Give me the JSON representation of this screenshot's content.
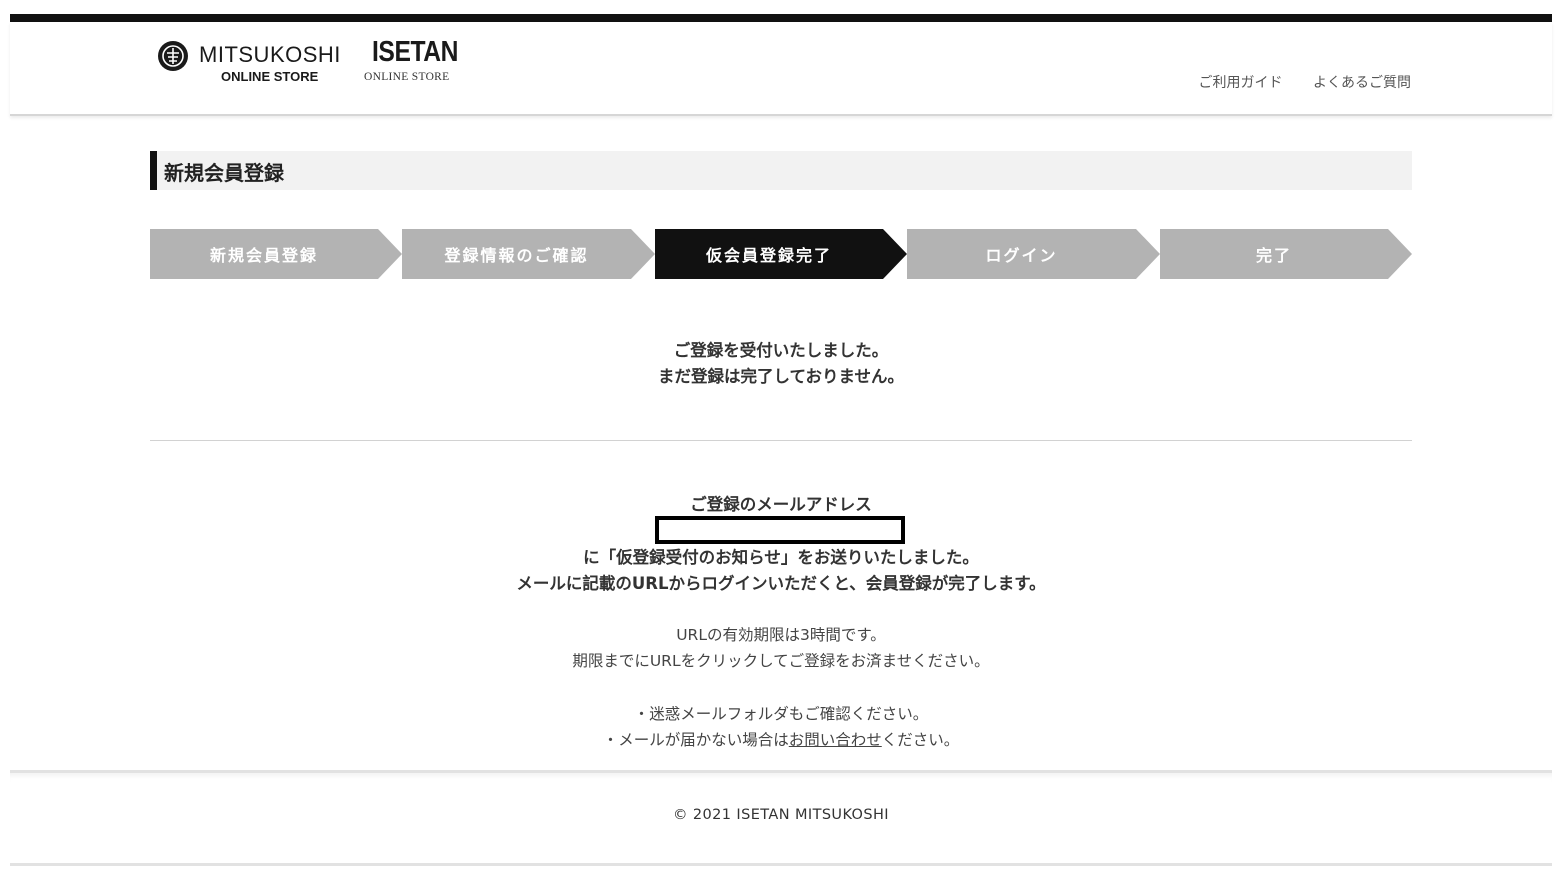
{
  "header": {
    "mitsukoshi_logo": {
      "name": "MITSUKOSHI",
      "sub": "ONLINE STORE"
    },
    "isetan_logo": {
      "name": "ISETAN",
      "sub": "ONLINE STORE"
    },
    "links": [
      {
        "label": "ご利用ガイド"
      },
      {
        "label": "よくあるご質問"
      }
    ]
  },
  "page_title": "新規会員登録",
  "steps": [
    {
      "label": "新規会員登録",
      "active": false
    },
    {
      "label": "登録情報のご確認",
      "active": false
    },
    {
      "label": "仮会員登録完了",
      "active": true
    },
    {
      "label": "ログイン",
      "active": false
    },
    {
      "label": "完了",
      "active": false
    }
  ],
  "message_top": {
    "line1": "ご登録を受付いたしました。",
    "line2": "まだ登録は完了しておりません。"
  },
  "email_section": {
    "label": "ご登録のメールアドレス",
    "email_value": "",
    "sent_line": "に「仮登録受付のお知らせ」をお送りいたしました。",
    "instruction_line": "メールに記載のURLからログインいただくと、会員登録が完了します。"
  },
  "expiry": {
    "line1": "URLの有効期限は3時間です。",
    "line2": "期限までにURLをクリックしてご登録をお済ませください。"
  },
  "notes": {
    "spam_note": "・迷惑メールフォルダもご確認ください。",
    "contact_prefix": "・メールが届かない場合は",
    "contact_link": "お問い合わせ",
    "contact_suffix": "ください。"
  },
  "footer": {
    "copyright": "© 2021 ISETAN MITSUKOSHI"
  },
  "colors": {
    "active_step": "#111111",
    "inactive_step": "#b3b3b3",
    "title_bg": "#f2f2f2"
  }
}
